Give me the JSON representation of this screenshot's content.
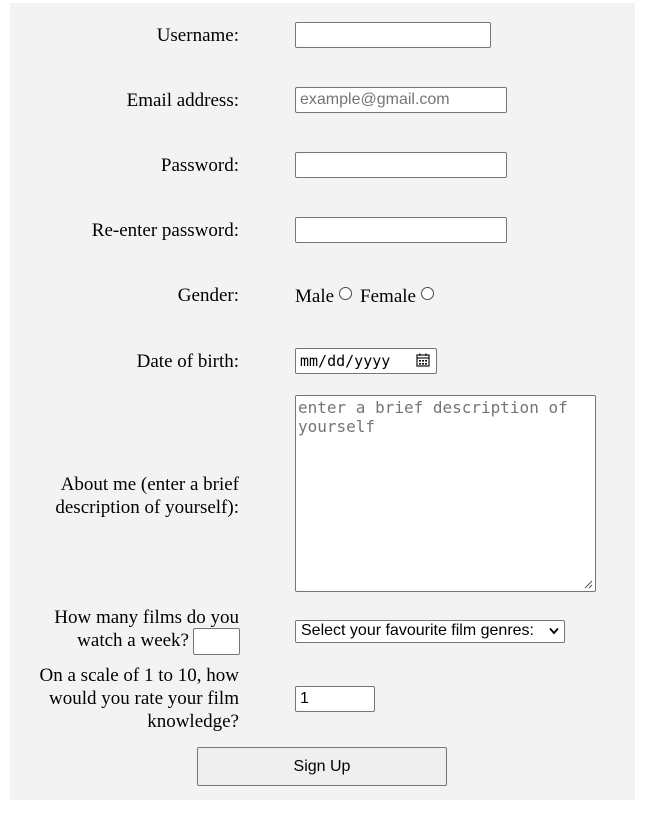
{
  "form": {
    "username_label": "Username:",
    "username_value": "",
    "email_label": "Email address:",
    "email_placeholder": "example@gmail.com",
    "password_label": "Password:",
    "reenter_label": "Re-enter password:",
    "gender_label": "Gender:",
    "gender_options": [
      "Male",
      "Female"
    ],
    "dob_label": "Date of birth:",
    "dob_placeholder": "mm/dd/yyyy",
    "about_label_line1": "About me (enter a brief",
    "about_label_line2": "description of yourself):",
    "about_placeholder": "enter a brief description of yourself",
    "films_label_line1": "How many films do you",
    "films_label_line2": "watch a week?",
    "films_value": "",
    "genres_selected": "Select your favourite film genres:",
    "rate_label_line1": "On a scale of 1 to 10, how",
    "rate_label_line2": "would you rate your film",
    "rate_label_line3": "knowledge?",
    "rate_value": "1",
    "submit_label": "Sign Up"
  },
  "icons": {
    "dob_icon": "calendar-icon",
    "select_icon": "chevron-down-icon",
    "resize_icon": "resize-grip-icon",
    "radio_icon": "radio-unchecked-icon"
  }
}
